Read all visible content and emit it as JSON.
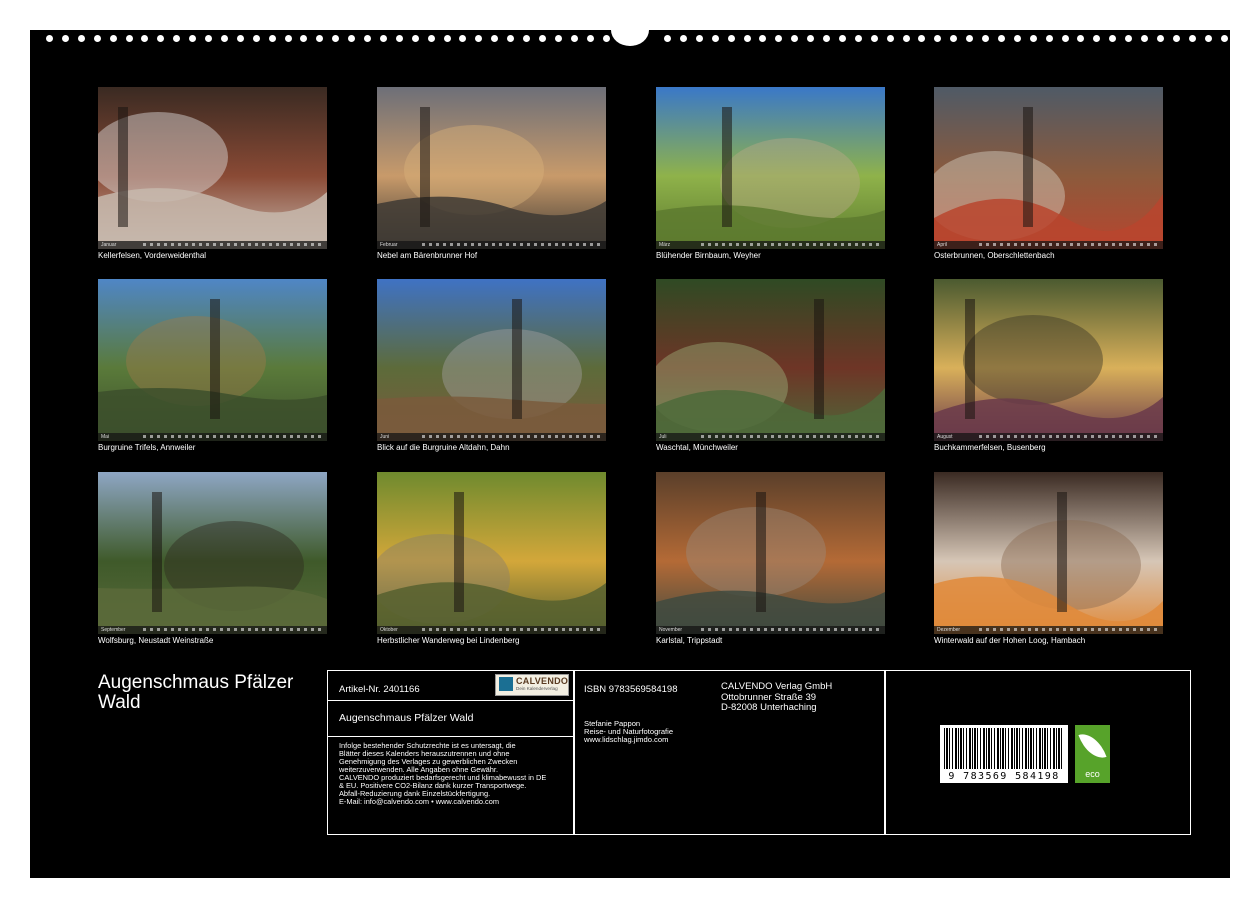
{
  "months": [
    {
      "caption": "Kellerfelsen, Vorderweidenthal",
      "month": "Januar",
      "palette": [
        "#3a2a22",
        "#8a4a35",
        "#c7b8ad",
        "#e0e0e0"
      ]
    },
    {
      "caption": "Nebel am Bärenbrunner Hof",
      "month": "Februar",
      "palette": [
        "#6d6f78",
        "#c89a6a",
        "#3e3a34",
        "#d9b27a"
      ]
    },
    {
      "caption": "Blühender Birnbaum, Weyher",
      "month": "März",
      "palette": [
        "#3a78c8",
        "#8fb24a",
        "#5d7a2f",
        "#b7a987"
      ]
    },
    {
      "caption": "Osterbrunnen, Oberschlettenbach",
      "month": "April",
      "palette": [
        "#4f5a66",
        "#8c5a3c",
        "#b8452e",
        "#d8d2c6"
      ]
    },
    {
      "caption": "Burgruine Trifels, Annweiler",
      "month": "Mai",
      "palette": [
        "#4f86c6",
        "#5a7a3a",
        "#3c4f2c",
        "#9b7a4a"
      ]
    },
    {
      "caption": "Blick auf die Burgruine Altdahn, Dahn",
      "month": "Juni",
      "palette": [
        "#3f72c4",
        "#5d6b3a",
        "#7a5a3c",
        "#a2a0a0"
      ]
    },
    {
      "caption": "Waschtal, Münchweiler",
      "month": "Juli",
      "palette": [
        "#2f4a24",
        "#6e3526",
        "#4d6a3a",
        "#9db07a"
      ]
    },
    {
      "caption": "Buchkammerfelsen, Busenberg",
      "month": "August",
      "palette": [
        "#4b5a30",
        "#d9b05a",
        "#6a3a4a",
        "#3a3626"
      ]
    },
    {
      "caption": "Wolfsburg, Neustadt Weinstraße",
      "month": "September",
      "palette": [
        "#8ea6c4",
        "#3f5a2a",
        "#5a6a3a",
        "#2f2a1e"
      ]
    },
    {
      "caption": "Herbstlicher Wanderweg bei Lindenberg",
      "month": "Oktober",
      "palette": [
        "#6f8a2e",
        "#d3a73a",
        "#56602f",
        "#8a7f6a"
      ]
    },
    {
      "caption": "Karlstal, Trippstadt",
      "month": "November",
      "palette": [
        "#5a3f2a",
        "#b46a36",
        "#3f4a40",
        "#9b8a7a"
      ]
    },
    {
      "caption": "Winterwald auf der Hohen Loog, Hambach",
      "month": "Dezember",
      "palette": [
        "#3a2a22",
        "#d6c6b6",
        "#e08a3a",
        "#8a6a52"
      ]
    }
  ],
  "title": "Augenschmaus Pfälzer Wald",
  "info": {
    "article": "Artikel-Nr. 2401166",
    "logo_brand": "CALVENDO",
    "logo_tagline": "Dein Kalenderverlag",
    "calendar_title": "Augenschmaus Pfälzer Wald",
    "legal": [
      "Infolge bestehender Schutzrechte ist es untersagt, die",
      "Blätter dieses Kalenders herauszutrennen und ohne",
      "Genehmigung des Verlages zu gewerblichen Zwecken",
      "weiterzuverwenden. Alle Angaben ohne Gewähr.",
      "CALVENDO produziert bedarfsgerecht und klimabewusst in DE",
      "& EU. Positivere CO2-Bilanz dank kurzer Transportwege.",
      "Abfall-Reduzierung dank Einzelstückfertigung.",
      "E-Mail: info@calvendo.com • www.calvendo.com"
    ],
    "isbn": "ISBN 9783569584198",
    "author": [
      "Stefanie Pappon",
      "Reise- und Naturfotografie",
      "www.lidschlag.jimdo.com"
    ],
    "publisher": [
      "CALVENDO Verlag GmbH",
      "Ottobrunner Straße 39",
      "D-82008 Unterhaching"
    ],
    "barcode_number": "9 783569 584198",
    "eco_label": "eco"
  }
}
